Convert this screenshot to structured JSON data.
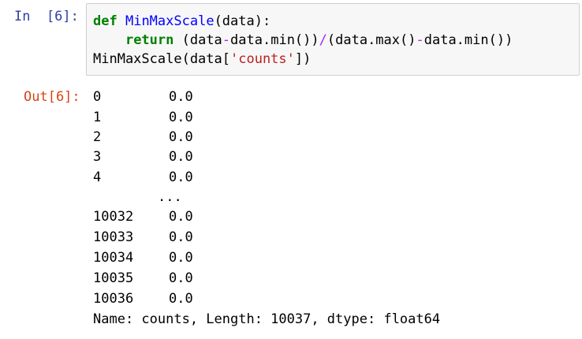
{
  "input": {
    "prompt": "In  [6]:",
    "code": {
      "line1": {
        "kw": "def",
        "fn": "MinMaxScale",
        "rest": "(data):"
      },
      "line2": {
        "indent": "    ",
        "kw": "return",
        "a": " (data",
        "op1": "-",
        "b": "data.min())",
        "op2": "/",
        "c": "(data.max()",
        "op3": "-",
        "d": "data.min())"
      },
      "line3": {
        "a": "MinMaxScale(data[",
        "str": "'counts'",
        "b": "])"
      }
    }
  },
  "output": {
    "prompt": "Out[6]:",
    "rows": [
      {
        "index": "0",
        "value": "0.0"
      },
      {
        "index": "1",
        "value": "0.0"
      },
      {
        "index": "2",
        "value": "0.0"
      },
      {
        "index": "3",
        "value": "0.0"
      },
      {
        "index": "4",
        "value": "0.0"
      }
    ],
    "ellipsis": "...",
    "rows_tail": [
      {
        "index": "10032",
        "value": "0.0"
      },
      {
        "index": "10033",
        "value": "0.0"
      },
      {
        "index": "10034",
        "value": "0.0"
      },
      {
        "index": "10035",
        "value": "0.0"
      },
      {
        "index": "10036",
        "value": "0.0"
      }
    ],
    "footer": "Name: counts, Length: 10037, dtype: float64"
  },
  "colors": {
    "in_prompt": "#303f9f",
    "out_prompt": "#d84315",
    "keyword": "#008000",
    "function_name": "#0000ff",
    "operator": "#aa22ff",
    "string": "#ba2121",
    "cell_background": "#f7f7f7"
  }
}
